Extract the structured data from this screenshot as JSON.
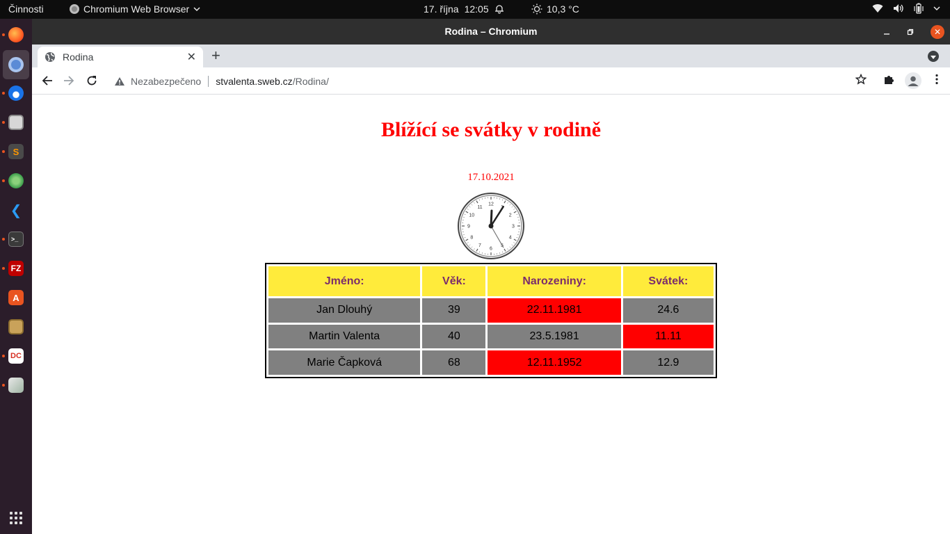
{
  "topbar": {
    "activities": "Činnosti",
    "app_name": "Chromium Web Browser",
    "date": "17. října",
    "time": "12:05",
    "weather": "10,3 °C"
  },
  "window": {
    "title": "Rodina – Chromium"
  },
  "browser": {
    "tab_title": "Rodina",
    "security_label": "Nezabezpečeno",
    "url_host": "stvalenta.sweb.cz",
    "url_path": "/Rodina/"
  },
  "page": {
    "heading": "Blížící se svátky v rodině",
    "date": "17.10.2021",
    "clock": {
      "hour": 12,
      "minute": 5,
      "second": 25,
      "numbers": [
        "12",
        "1",
        "2",
        "3",
        "4",
        "5",
        "6",
        "7",
        "8",
        "9",
        "10",
        "11"
      ]
    },
    "table": {
      "headers": [
        "Jméno:",
        "Věk:",
        "Narozeniny:",
        "Svátek:"
      ],
      "rows": [
        {
          "name": "Jan Dlouhý",
          "age": "39",
          "birthday": "22.11.1981",
          "nameday": "24.6",
          "birthday_highlight": true,
          "nameday_highlight": false
        },
        {
          "name": "Martin Valenta",
          "age": "40",
          "birthday": "23.5.1981",
          "nameday": "11.11",
          "birthday_highlight": false,
          "nameday_highlight": true
        },
        {
          "name": "Marie Čapková",
          "age": "68",
          "birthday": "12.11.1952",
          "nameday": "12.9",
          "birthday_highlight": true,
          "nameday_highlight": false
        }
      ]
    }
  },
  "colors": {
    "heading": "#ff0000",
    "header_bg": "#ffeb3b",
    "header_text": "#7b2c6b",
    "cell_bg": "#808080",
    "highlight": "#ff0000",
    "ubuntu_accent": "#e95420"
  },
  "dock": {
    "items": [
      "firefox-icon",
      "chromium-icon",
      "thunderbird-icon",
      "files-icon",
      "sublime-text-icon",
      "web-app-icon",
      "vscode-icon",
      "terminal-icon",
      "filezilla-icon",
      "software-center-icon",
      "archive-manager-icon",
      "dc-app-icon",
      "image-viewer-icon"
    ]
  }
}
